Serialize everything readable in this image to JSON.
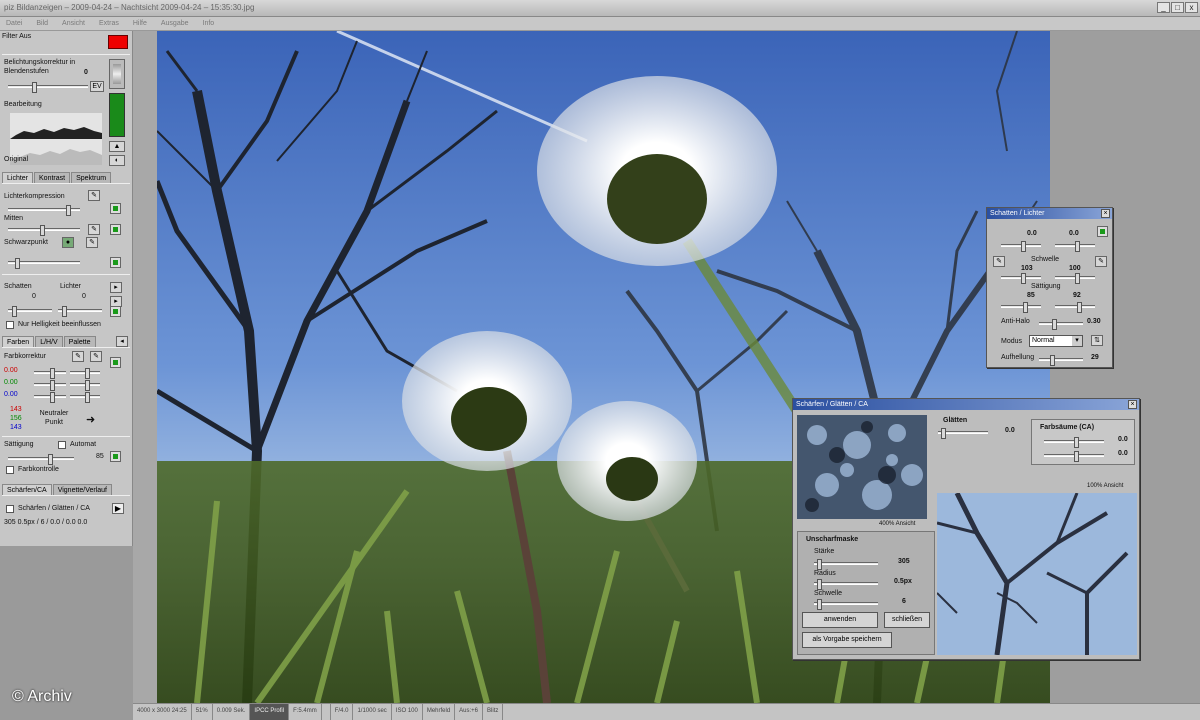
{
  "window": {
    "title": "piz Bildanzeigen – 2009-04-24 – Nachtsicht 2009-04-24 – 15:35:30.jpg",
    "controls": [
      "_",
      "□",
      "x"
    ]
  },
  "menu": [
    "Datei",
    "Bild",
    "Ansicht",
    "Extras",
    "Hilfe",
    "Ausgabe",
    "Info"
  ],
  "left_panel": {
    "filter_label": "Filter Aus",
    "exposure_label": "Belichtungskorrektur in Blendenstufen",
    "exposure_value": "0",
    "ev_button": "EV",
    "histogram_after_label": "Bearbeitung",
    "histogram_before_label": "Original",
    "tabs_top": [
      "Lichter",
      "Kontrast",
      "Spektrum"
    ],
    "highlight_compression_label": "Lichterkompression",
    "midtones_label": "Mitten",
    "blackpoint_label": "Schwarzpunkt",
    "shadows_label": "Schatten",
    "lights_label": "Lichter",
    "shadows_value": "0",
    "lights_value": "0",
    "only_highlights_label": "Nur Helligkeit beeinflussen",
    "tabs_color": [
      "Farben",
      "L/H/V",
      "Palette"
    ],
    "color_correction_label": "Farbkorrektur",
    "rgb_values": [
      "0.00",
      "0.00",
      "0.00"
    ],
    "neutral_values": [
      "143",
      "156",
      "143"
    ],
    "neutral_point_label": "Neutraler Punkt",
    "saturation_label": "Sättigung",
    "automatic_label": "Automat",
    "saturation_value": "85",
    "color_control_label": "Farbkontrolle",
    "tabs_sharpen": [
      "Schärfen/CA",
      "Vignette/Verlauf"
    ],
    "sharpen_check_label": "Schärfen / Glätten / CA",
    "sharpen_summary": "305  0.5px  / 6 / 0.0 / 0.0 0.0"
  },
  "dialog_shadows": {
    "title": "Schatten / Lichter",
    "val_left": "0.0",
    "val_right": "0.0",
    "radius_label": "Schwelle",
    "radius_left": "103",
    "radius_right": "100",
    "saturation_label": "Sättigung",
    "sat_left": "85",
    "sat_right": "92",
    "antiveil_label": "Anti-Halo",
    "antiveil_value": "0.30",
    "mode_label": "Modus",
    "mode_value": "Normal",
    "brightening_label": "Aufhellung",
    "brightening_value": "29"
  },
  "dialog_sharpen": {
    "title": "Schärfen / Glätten / CA",
    "glaetten_label": "Glätten",
    "glaetten_value": "0.0",
    "ca_label": "Farbsäume (CA)",
    "ca_red": "0.0",
    "ca_blue": "0.0",
    "zoom_left": "400% Ansicht",
    "zoom_right": "100% Ansicht",
    "unsharp_label": "Unscharfmaske",
    "stärke_label": "Stärke",
    "stärke_value": "305",
    "radius_label": "Radius",
    "radius_value": "0.5px",
    "schwelle_label": "Schwelle",
    "schwelle_value": "6",
    "apply_button": "anwenden",
    "close_button": "schließen",
    "save_default_button": "als Vorgabe speichern"
  },
  "statusbar": [
    {
      "text": "4000 x 3000 24:25",
      "hl": false
    },
    {
      "text": "51%",
      "hl": false
    },
    {
      "text": "0.009 Sek.",
      "hl": false
    },
    {
      "text": "IPCC Profil",
      "hl": true
    },
    {
      "text": "F:5.4mm",
      "hl": false
    },
    {
      "text": "",
      "hl": false
    },
    {
      "text": "F/4.0",
      "hl": false
    },
    {
      "text": "1/1000 sec",
      "hl": false
    },
    {
      "text": "ISO 100",
      "hl": false
    },
    {
      "text": "Mehrfeld",
      "hl": false
    },
    {
      "text": "Aus:+6",
      "hl": false
    },
    {
      "text": "Blitz",
      "hl": false
    }
  ],
  "watermark": "© Archiv",
  "colors": {
    "accent": "#2a4fa0",
    "sky": "#4a6fb5",
    "panel": "#c6c6c6"
  }
}
